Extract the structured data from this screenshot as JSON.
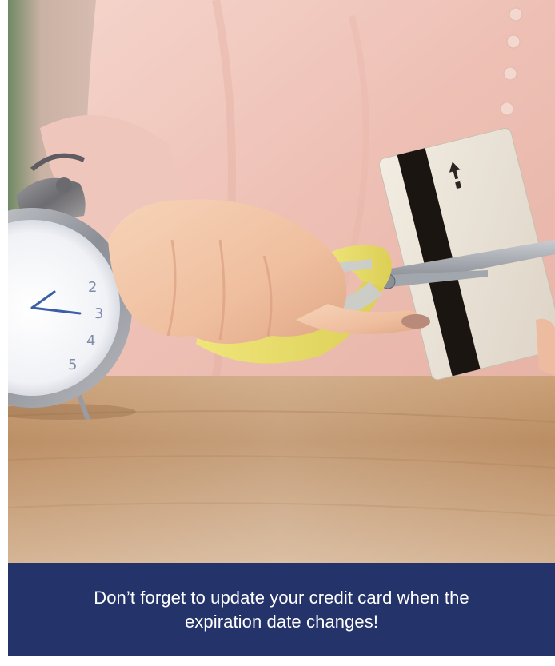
{
  "caption": {
    "text": "Don’t forget to update your credit card when the expiration date changes!"
  },
  "photo": {
    "subjects": [
      "alarm-clock",
      "hand",
      "scissors",
      "credit-card",
      "wooden-table"
    ]
  },
  "colors": {
    "caption_background": "#24336a",
    "caption_text": "#ffffff",
    "table": "#b98a5e",
    "shirt": "#f0c7bd",
    "scissors_handle": "#e8df6a",
    "card": "#ece5da",
    "magnetic_stripe": "#1b1512"
  }
}
